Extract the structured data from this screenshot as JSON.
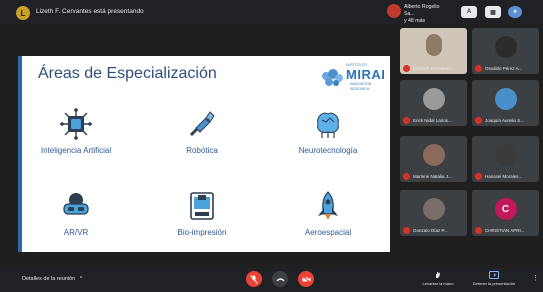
{
  "top_bar": {
    "presenter_initial": "L",
    "presenter_text": "Lizeth F. Cervantes está presentando",
    "self_name": "Alberto Rogelio Sa...",
    "self_status": "y 48 más"
  },
  "slide": {
    "title": "Áreas de Especialización",
    "logo": {
      "small_text": "INSTITUTO",
      "name": "MIRAI",
      "subtitle": "INNOVATION RESEARCH"
    },
    "areas": [
      {
        "label": "Inteligencia Artificial",
        "icon": "ai-chip-icon"
      },
      {
        "label": "Robótica",
        "icon": "robot-arm-icon"
      },
      {
        "label": "Neurotecnología",
        "icon": "brain-circuit-icon"
      },
      {
        "label": "AR/VR",
        "icon": "vr-headset-icon"
      },
      {
        "label": "Bio-impresión",
        "icon": "bio-printer-icon"
      },
      {
        "label": "Aeroespacial",
        "icon": "rocket-icon"
      }
    ]
  },
  "participants": [
    {
      "name": "Lizeth F. Cervantes",
      "avatar_color": "#8d7b6a"
    },
    {
      "name": "Osvaldo Pérez A...",
      "avatar_color": "#2c2c2c"
    },
    {
      "name": "Erick Nidal Larios...",
      "avatar_color": "#9a9a9a"
    },
    {
      "name": "Joaquín Aurelio S...",
      "avatar_color": "#4a90c8"
    },
    {
      "name": "Marlene Natalia J...",
      "avatar_color": "#8a6a5a"
    },
    {
      "name": "Hanssel Morales...",
      "avatar_color": "#3a3a3a"
    },
    {
      "name": "Gonzalo Díaz P...",
      "avatar_color": "#7a6e6a"
    },
    {
      "name": "CHRISTIAN APRI...",
      "avatar_color": "#c2185b",
      "initial": "C"
    }
  ],
  "bottom_bar": {
    "meeting_details": "Detalles de la reunión",
    "raise_hand": "Levantar la mano",
    "stop_presenting": "Detener la presentación"
  }
}
